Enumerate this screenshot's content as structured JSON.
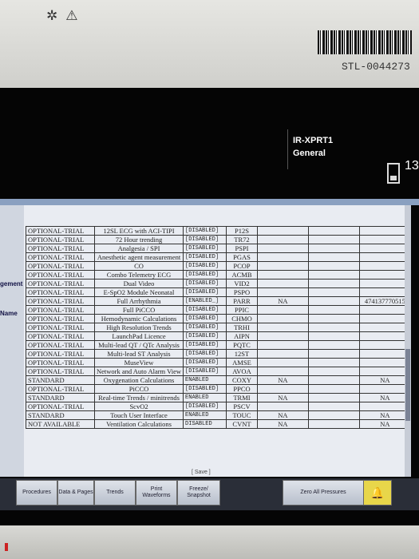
{
  "bezel": {
    "icons": [
      "✲",
      "⚠"
    ],
    "asset_tag": "STL-0044273"
  },
  "header": {
    "device_name": "IR-XPRT1",
    "profile": "General",
    "bed_number": "13"
  },
  "side_labels": [
    "gement",
    "Name"
  ],
  "options_table": {
    "rows": [
      {
        "status": "OPTIONAL-TRIAL",
        "feature": "12SL ECG with ACI-TIPI",
        "enabled": "[DISABLED]",
        "code": "P12S",
        "c5": "",
        "c6": "",
        "c7": ""
      },
      {
        "status": "OPTIONAL-TRIAL",
        "feature": "72 Hour trending",
        "enabled": "[DISABLED]",
        "code": "TR72",
        "c5": "",
        "c6": "",
        "c7": ""
      },
      {
        "status": "OPTIONAL-TRIAL",
        "feature": "Analgesia / SPI",
        "enabled": "[DISABLED]",
        "code": "PSPI",
        "c5": "",
        "c6": "",
        "c7": ""
      },
      {
        "status": "OPTIONAL-TRIAL",
        "feature": "Anesthetic agent measurement",
        "enabled": "[DISABLED]",
        "code": "PGAS",
        "c5": "",
        "c6": "",
        "c7": ""
      },
      {
        "status": "OPTIONAL-TRIAL",
        "feature": "CO",
        "enabled": "[DISABLED]",
        "code": "PCOP",
        "c5": "",
        "c6": "",
        "c7": ""
      },
      {
        "status": "OPTIONAL-TRIAL",
        "feature": "Combo Telemetry ECG",
        "enabled": "[DISABLED]",
        "code": "ACMB",
        "c5": "",
        "c6": "",
        "c7": ""
      },
      {
        "status": "OPTIONAL-TRIAL",
        "feature": "Dual Video",
        "enabled": "[DISABLED]",
        "code": "VID2",
        "c5": "",
        "c6": "",
        "c7": ""
      },
      {
        "status": "OPTIONAL-TRIAL",
        "feature": "E-SpO2 Module Neonatal",
        "enabled": "[DISABLED]",
        "code": "PSPO",
        "c5": "",
        "c6": "",
        "c7": ""
      },
      {
        "status": "OPTIONAL-TRIAL",
        "feature": "Full Arrhythmia",
        "enabled": "[ENABLED_]",
        "code": "PARR",
        "c5": "NA",
        "c6": "",
        "c7": "474137770515"
      },
      {
        "status": "OPTIONAL-TRIAL",
        "feature": "Full PiCCO",
        "enabled": "[DISABLED]",
        "code": "PPIC",
        "c5": "",
        "c6": "",
        "c7": ""
      },
      {
        "status": "OPTIONAL-TRIAL",
        "feature": "Hemodynamic Calculations",
        "enabled": "[DISABLED]",
        "code": "CHMO",
        "c5": "",
        "c6": "",
        "c7": ""
      },
      {
        "status": "OPTIONAL-TRIAL",
        "feature": "High Resolution Trends",
        "enabled": "[DISABLED]",
        "code": "TRHI",
        "c5": "",
        "c6": "",
        "c7": ""
      },
      {
        "status": "OPTIONAL-TRIAL",
        "feature": "LaunchPad Licence",
        "enabled": "[DISABLED]",
        "code": "AIPN",
        "c5": "",
        "c6": "",
        "c7": ""
      },
      {
        "status": "OPTIONAL-TRIAL",
        "feature": "Multi-lead QT / QTc Analysis",
        "enabled": "[DISABLED]",
        "code": "PQTC",
        "c5": "",
        "c6": "",
        "c7": ""
      },
      {
        "status": "OPTIONAL-TRIAL",
        "feature": "Multi-lead ST Analysis",
        "enabled": "[DISABLED]",
        "code": "12ST",
        "c5": "",
        "c6": "",
        "c7": ""
      },
      {
        "status": "OPTIONAL-TRIAL",
        "feature": "MuseView",
        "enabled": "[DISABLED]",
        "code": "AMSE",
        "c5": "",
        "c6": "",
        "c7": ""
      },
      {
        "status": "OPTIONAL-TRIAL",
        "feature": "Network and Auto Alarm View",
        "enabled": "[DISABLED]",
        "code": "AVOA",
        "c5": "",
        "c6": "",
        "c7": ""
      },
      {
        "status": "STANDARD",
        "feature": "Oxygenation Calculations",
        "enabled": "ENABLED",
        "code": "COXY",
        "c5": "NA",
        "c6": "",
        "c7": "NA"
      },
      {
        "status": "OPTIONAL-TRIAL",
        "feature": "PiCCO",
        "enabled": "[DISABLED]",
        "code": "PPCO",
        "c5": "",
        "c6": "",
        "c7": ""
      },
      {
        "status": "STANDARD",
        "feature": "Real-time Trends / minitrends",
        "enabled": "ENABLED",
        "code": "TRMI",
        "c5": "NA",
        "c6": "",
        "c7": "NA"
      },
      {
        "status": "OPTIONAL-TRIAL",
        "feature": "ScvO2",
        "enabled": "[DISABLED]",
        "code": "PSCV",
        "c5": "",
        "c6": "",
        "c7": ""
      },
      {
        "status": "STANDARD",
        "feature": "Touch User Interface",
        "enabled": "ENABLED",
        "code": "TOUC",
        "c5": "NA",
        "c6": "",
        "c7": "NA"
      },
      {
        "status": "NOT AVAILABLE",
        "feature": "Ventilation Calculations",
        "enabled": "DISABLED",
        "code": "CVNT",
        "c5": "NA",
        "c6": "",
        "c7": "NA"
      }
    ]
  },
  "save_label": "[ Save ]",
  "buttons": [
    {
      "label": "Procedures"
    },
    {
      "label": "Data & Pages"
    },
    {
      "label": "Trends"
    },
    {
      "label": "Print Waveforms"
    },
    {
      "label": "Freeze/ Snapshot"
    },
    {
      "label": "Zero All Pressures"
    }
  ]
}
